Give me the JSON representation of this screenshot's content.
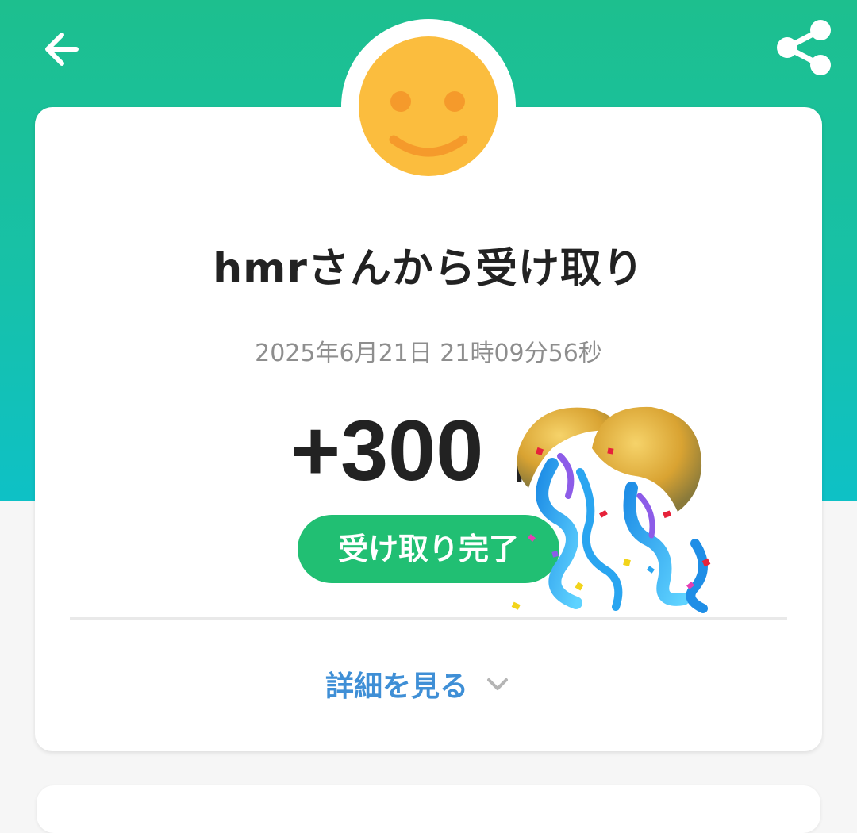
{
  "header": {
    "back_icon": "arrow-left-icon",
    "share_icon": "share-icon",
    "background_top": "#1dbf8e",
    "background_bottom": "#0ec1c6"
  },
  "avatar": {
    "icon": "smiley-face-icon",
    "color": "#fbbd3e"
  },
  "transaction": {
    "title": "hmrさんから受け取り",
    "timestamp": "2025年6月21日 21時09分56秒",
    "amount": "+300",
    "unit": "p",
    "status": "受け取り完了",
    "status_color": "#21bf73"
  },
  "details": {
    "label": "詳細を見る",
    "icon": "chevron-down-icon",
    "color": "#3f8fd6"
  },
  "decoration": {
    "icon": "kusudama-celebration-icon"
  }
}
